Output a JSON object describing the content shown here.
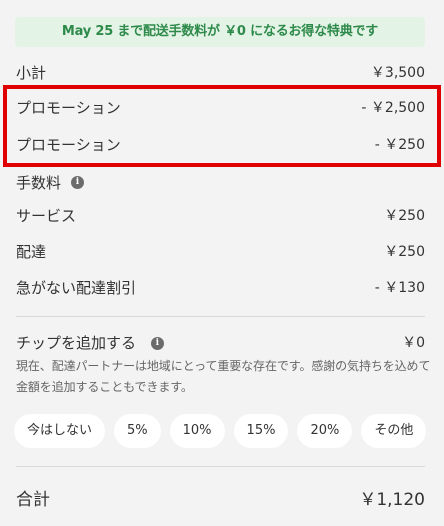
{
  "banner": {
    "text": "May 25 まで配送手数料が ￥0 になるお得な特典です"
  },
  "summary": {
    "subtotal": {
      "label": "小計",
      "value": "￥3,500"
    },
    "promotions": [
      {
        "label": "プロモーション",
        "value": "- ￥2,500"
      },
      {
        "label": "プロモーション",
        "value": "- ￥250"
      }
    ],
    "fees_label": "手数料",
    "service": {
      "label": "サービス",
      "value": "￥250"
    },
    "delivery": {
      "label": "配達",
      "value": "￥250"
    },
    "no_rush_discount": {
      "label": "急がない配達割引",
      "value": "- ￥130"
    }
  },
  "tip": {
    "label": "チップを追加する",
    "value": "￥0",
    "description": "現在、配達パートナーは地域にとって重要な存在です。感謝の気持ちを込めて金額を追加することもできます。",
    "options": [
      "今はしない",
      "5%",
      "10%",
      "15%",
      "20%",
      "その他"
    ]
  },
  "total": {
    "label": "合計",
    "value": "￥1,120"
  },
  "colors": {
    "highlight": "#e00000",
    "banner_bg": "#e3f3e6",
    "banner_text": "#2e8a4a"
  },
  "icons": {
    "info": "info-icon"
  }
}
